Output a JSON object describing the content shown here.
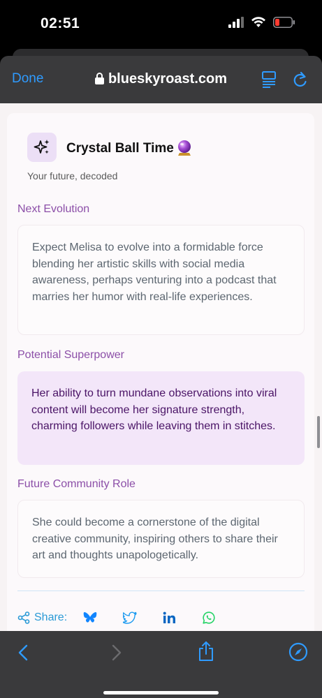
{
  "status": {
    "time": "02:51"
  },
  "browser": {
    "done_label": "Done",
    "url": "blueskyroast.com"
  },
  "card": {
    "title": "Crystal Ball Time",
    "subtitle": "Your future, decoded",
    "sections": [
      {
        "label": "Next Evolution",
        "text": "Expect Melisa to evolve into a formidable force blending her artistic skills with social media awareness, perhaps venturing into a podcast that marries her humor with real-life experiences."
      },
      {
        "label": "Potential Superpower",
        "text": "Her ability to turn mundane observations into viral content will become her signature strength, charming followers while leaving them in stitches."
      },
      {
        "label": "Future Community Role",
        "text": "She could become a cornerstone of the digital creative community, inspiring others to share their art and thoughts unapologetically."
      }
    ]
  },
  "share": {
    "label": "Share:"
  },
  "colors": {
    "accent_purple": "#8c4fa8",
    "highlight_bg": "#f3e6f9",
    "link_blue": "#2f9bff",
    "share_blue": "#2a9ad6",
    "whatsapp_green": "#25d366",
    "battery_red": "#ff3b30"
  },
  "icons": [
    "signal-icon",
    "wifi-icon",
    "battery-icon",
    "lock-icon",
    "reader-icon",
    "reload-icon",
    "sparkles-icon",
    "crystal-ball-icon",
    "share-icon",
    "bluesky-icon",
    "twitter-icon",
    "linkedin-icon",
    "whatsapp-icon",
    "back-icon",
    "forward-icon",
    "share-sheet-icon",
    "compass-icon"
  ]
}
